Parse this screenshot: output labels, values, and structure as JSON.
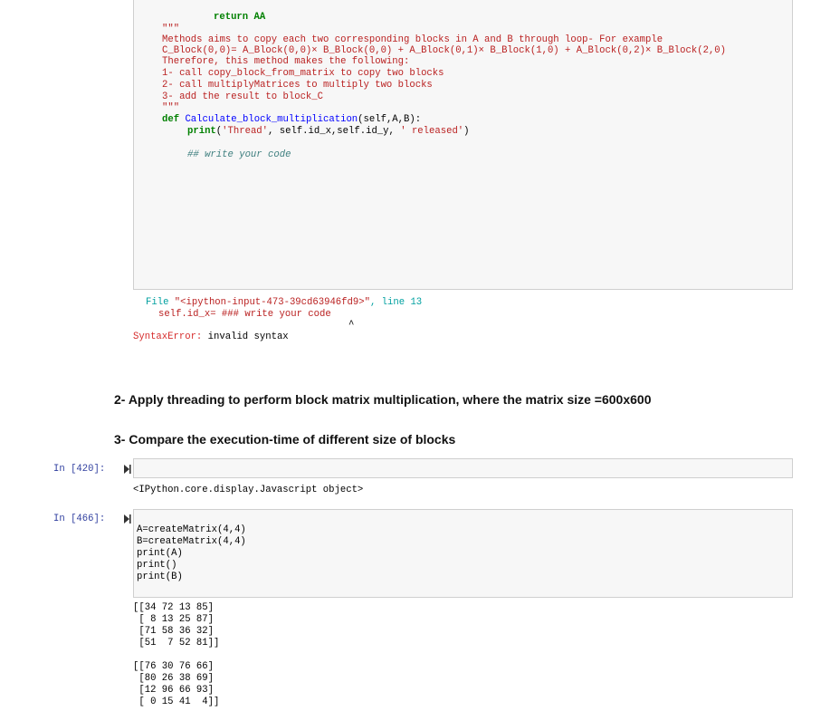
{
  "cell_top": {
    "code": {
      "return_line": "return AA",
      "doc_open": "\"\"\"",
      "doc_l1": "Methods aims to copy each two corresponding blocks in A and B through loop- For example",
      "doc_l2": "C_Block(0,0)= A_Block(0,0)× B_Block(0,0) + A_Block(0,1)× B_Block(1,0) + A_Block(0,2)× B_Block(2,0)",
      "doc_l3": "Therefore, this method makes the following:",
      "doc_l4": "1- call copy_block_from_matrix to copy two blocks",
      "doc_l5": "2- call multiplyMatrices to multiply two blocks",
      "doc_l6": "3- add the result to block_C",
      "doc_close": "\"\"\"",
      "def_kw": "def",
      "def_name": "Calculate_block_multiplication",
      "def_args": "(self,A,B):",
      "print_kw": "print",
      "print_p1": "(",
      "print_s1": "'Thread'",
      "print_mid": ", self.id_x,self.id_y, ",
      "print_s2": "' released'",
      "print_end": ")",
      "comment": "## write your code"
    },
    "traceback": {
      "file_label": "File ",
      "file_path": "\"<ipython-input-473-39cd63946fd9>\"",
      "line_text": ", line 13",
      "code_line": "self.id_x= ### write your code",
      "caret": "^",
      "error_name": "SyntaxError:",
      "error_msg": "invalid syntax"
    }
  },
  "headings": {
    "h2": "2- Apply threading to perform block matrix multiplication, where the matrix size =600x600",
    "h3": "3- Compare the execution-time of different size of blocks"
  },
  "cell_420": {
    "prompt": "In [420]:",
    "output": "<IPython.core.display.Javascript object>"
  },
  "cell_466": {
    "prompt": "In [466]:",
    "lines": [
      "A=createMatrix(4,4)",
      "B=createMatrix(4,4)",
      "print(A)",
      "print()",
      "print(B)"
    ],
    "output_A": [
      "[[34 72 13 85]",
      " [ 8 13 25 87]",
      " [71 58 36 32]",
      " [51  7 52 81]]"
    ],
    "output_B": [
      "[[76 30 76 66]",
      " [80 26 38 69]",
      " [12 96 66 93]",
      " [ 0 15 41  4]]"
    ]
  }
}
